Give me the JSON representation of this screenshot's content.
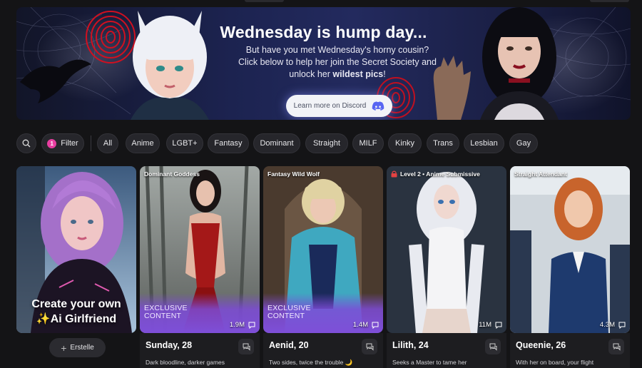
{
  "banner": {
    "title": "Wednesday is hump day...",
    "subtitle_line1": "But have you met Wednesday's horny cousin?",
    "subtitle_line2": "Click below to help her join the Secret Society and",
    "subtitle_line3_pre": "unlock her ",
    "subtitle_line3_bold": "wildest pics",
    "subtitle_line3_post": "!",
    "cta_label": "Learn more on Discord",
    "cta_icon": "discord-icon"
  },
  "filters": {
    "search_icon": "search-icon",
    "filter_label": "Filter",
    "filter_count": "1",
    "categories": [
      "All",
      "Anime",
      "LGBT+",
      "Fantasy",
      "Dominant",
      "Straight",
      "MILF",
      "Kinky",
      "Trans",
      "Lesbian",
      "Gay"
    ]
  },
  "create_card": {
    "line1": "Create your own",
    "line2": "✨Ai Girlfriend",
    "button_label": "Erstelle",
    "button_icon": "plus-icon"
  },
  "cards": [
    {
      "tag": "Dominant Goddess",
      "exclusive": "EXCLUSIVE\nCONTENT",
      "count": "1.9M",
      "name": "Sunday, 28",
      "desc": "Dark bloodline, darker games",
      "locked": false
    },
    {
      "tag": "Fantasy Wild Wolf",
      "exclusive": "EXCLUSIVE\nCONTENT",
      "count": "1.4M",
      "name": "Aenid, 20",
      "desc": "Two sides, twice the trouble 🌙",
      "locked": false
    },
    {
      "tag": "Level 2 • Anime Submissive",
      "exclusive": "",
      "count": "11M",
      "name": "Lilith, 24",
      "desc": "Seeks a Master to tame her",
      "locked": true
    },
    {
      "tag": "Straight Attendant",
      "exclusive": "",
      "count": "4.3M",
      "name": "Queenie, 26",
      "desc": "With her on board, your flight",
      "locked": false
    }
  ],
  "colors": {
    "accent": "#e83ea1",
    "exclusive": "#7e4fd8",
    "bg": "#141416"
  }
}
